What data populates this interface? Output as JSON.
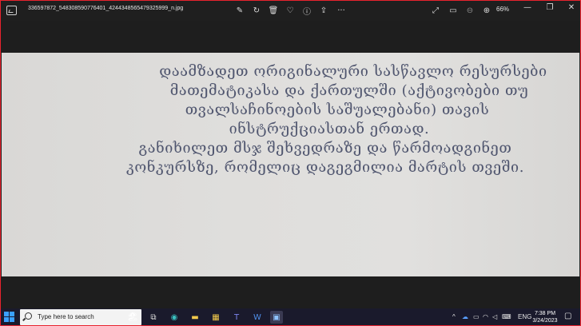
{
  "titlebar": {
    "filename": "336597872_548308590776401_4244348565479325999_n.jpg",
    "zoom": "66%",
    "icons": [
      "image-app-icon",
      "edit-image-icon",
      "rotate-icon",
      "delete-icon",
      "favorite-heart-icon",
      "info-icon",
      "share-icon",
      "more-icon",
      "fullscreen-icon",
      "slideshow-icon",
      "zoom-out-icon",
      "zoom-in-icon"
    ]
  },
  "photo": {
    "lines": [
      "დაამზადეთ ორიგინალური სასწავლო რესურსები",
      "მათემატიკასა და ქართულში (აქტივობები თუ",
      "თვალსაჩინოების საშუალებანი) თავის",
      "ინსტრუქციასთან ერთად.",
      "განიხილეთ მსჯ შეხვედრაზე და წარმოადგინეთ",
      "კონკურსზე, რომელიც დაგეგმილია მარტის თვეში."
    ]
  },
  "taskbar": {
    "search_placeholder": "Type here to search",
    "language": "ENG",
    "time": "7:38 PM",
    "date": "3/24/2023",
    "colors": {
      "background": "#1a1a2c",
      "accent": "#3aa0ff"
    }
  }
}
